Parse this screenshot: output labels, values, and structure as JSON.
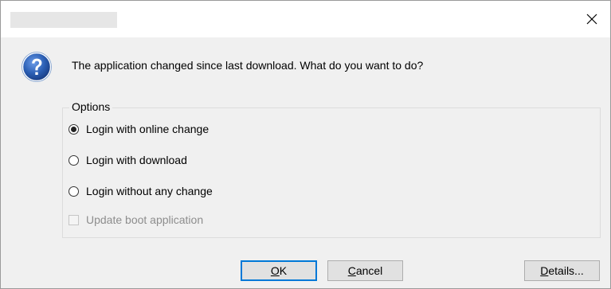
{
  "window": {
    "close_glyph": "✕",
    "icons": {
      "question": "question-icon",
      "close": "close-icon"
    },
    "colors": {
      "icon_blue": "#2b5fb4",
      "default_button_border": "#0078d7",
      "group_border": "#dcdcdc"
    }
  },
  "message": {
    "text": "The application changed since last download. What do you want to do?"
  },
  "options": {
    "legend": "Options",
    "selected_index": 0,
    "items": [
      {
        "label": "Login with online change",
        "selected": true
      },
      {
        "label": "Login with download",
        "selected": false
      },
      {
        "label": "Login without any change",
        "selected": false
      }
    ],
    "update_boot": {
      "label": "Update boot application",
      "checked": false,
      "enabled": false
    }
  },
  "buttons": {
    "ok": {
      "mnemonic": "O",
      "rest": "K"
    },
    "cancel": {
      "mnemonic": "C",
      "rest": "ancel"
    },
    "details": {
      "mnemonic": "D",
      "rest": "etails..."
    }
  }
}
